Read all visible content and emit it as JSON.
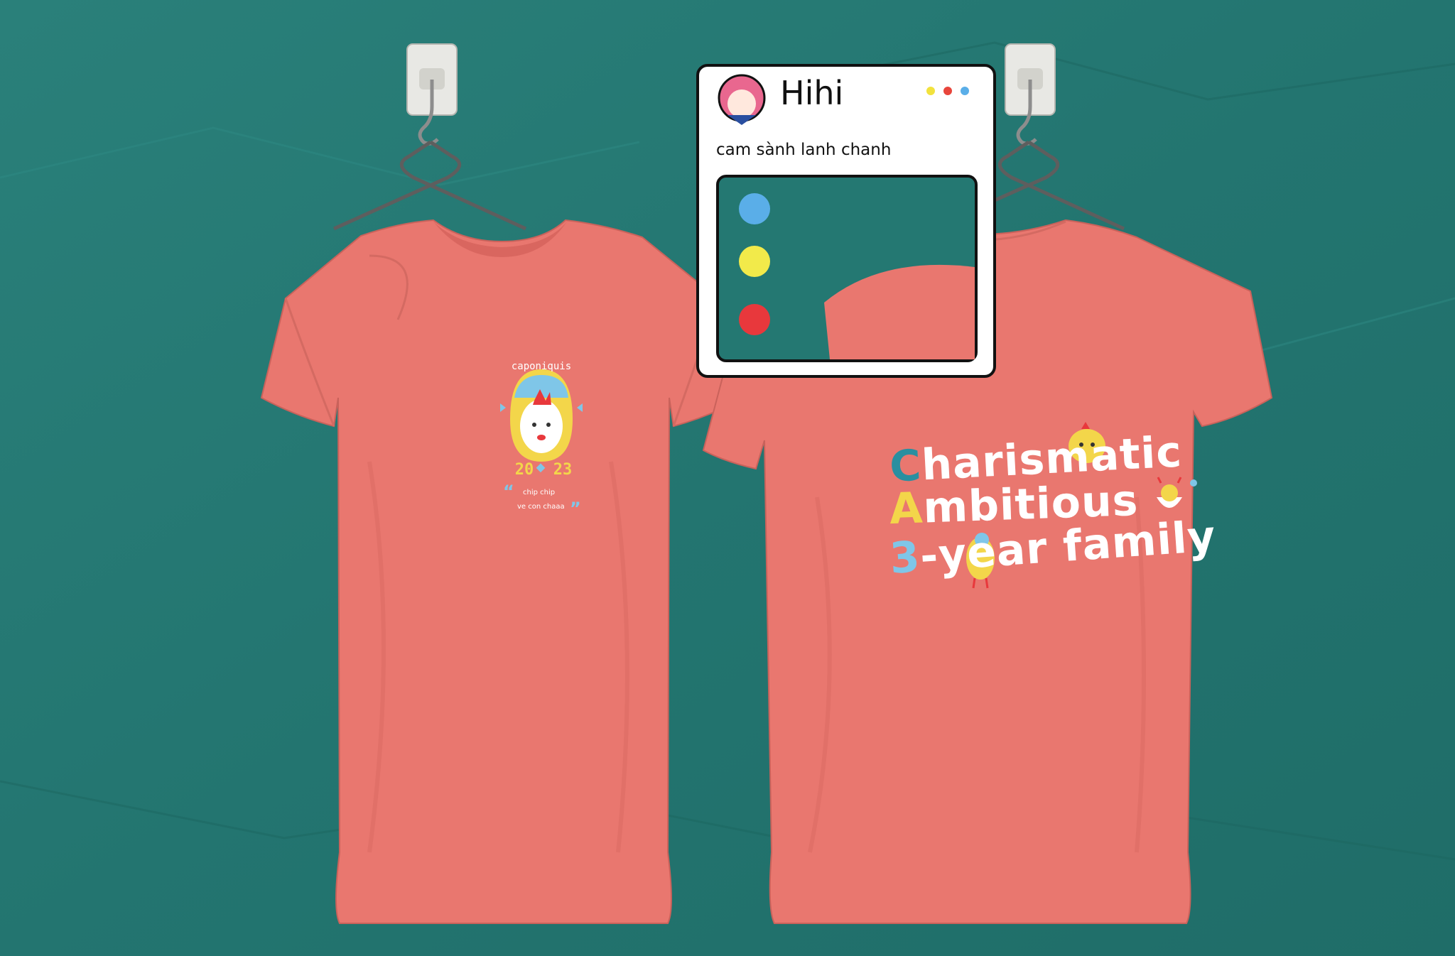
{
  "card": {
    "title": "Hihi",
    "subtitle": "cam sành lanh chanh",
    "header_dot_colors": [
      "#f2e23d",
      "#e8453b",
      "#5aaee8"
    ],
    "swatches": [
      {
        "color": "#5aaee8"
      },
      {
        "color": "#f2ea4a"
      },
      {
        "color": "#e8383c"
      }
    ]
  },
  "front_logo": {
    "arc_text": "caponiquis",
    "year_left": "20",
    "year_right": "23",
    "quote_line1": "chip chip",
    "quote_line2": "ve con chaaa"
  },
  "back_print": {
    "line1_initial": "C",
    "line1_rest": "harismatic",
    "line2_initial": "A",
    "line2_rest": "mbitious",
    "line3_initial": "3",
    "line3_rest": "-year family"
  },
  "colors": {
    "background": "#247872",
    "shirt": "#e9776f",
    "shirt_shadow": "#d9665f",
    "initial_c": "#2a8fa0",
    "initial_a": "#f3d64a",
    "initial_3": "#7fc6e8"
  }
}
